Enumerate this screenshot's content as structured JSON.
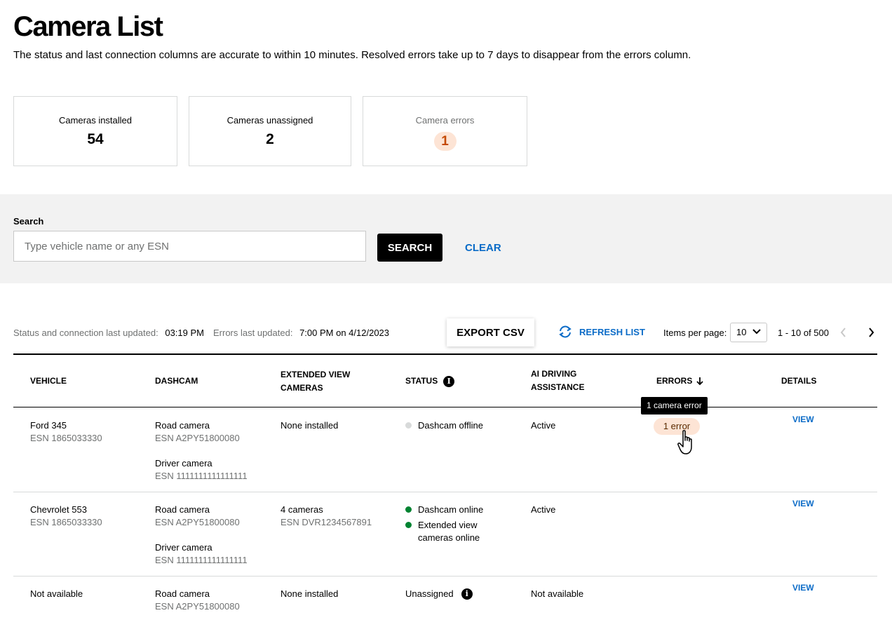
{
  "page": {
    "title": "Camera List",
    "description": "The status and last connection columns are accurate to within 10 minutes. Resolved errors take up to 7 days to disappear from the errors column."
  },
  "stats": [
    {
      "label": "Cameras installed",
      "value": "54"
    },
    {
      "label": "Cameras unassigned",
      "value": "2"
    },
    {
      "label": "Camera errors",
      "value": "1"
    }
  ],
  "search": {
    "label": "Search",
    "placeholder": "Type vehicle name or any ESN",
    "button": "SEARCH",
    "clear": "CLEAR"
  },
  "toolbar": {
    "status_updated_label": "Status and connection last updated:",
    "status_updated_value": "03:19 PM",
    "errors_updated_label": "Errors last updated:",
    "errors_updated_value": "7:00 PM on 4/12/2023",
    "export": "EXPORT CSV",
    "refresh": "REFRESH LIST",
    "items_per_page_label": "Items per page:",
    "items_per_page_value": "10",
    "range": "1 - 10 of 500"
  },
  "table": {
    "headers": {
      "vehicle": "VEHICLE",
      "dashcam": "DASHCAM",
      "extended_1": "EXTENDED VIEW",
      "extended_2": "CAMERAS",
      "status": "STATUS",
      "ai_1": "AI DRIVING",
      "ai_2": "ASSISTANCE",
      "errors": "ERRORS",
      "details": "DETAILS"
    },
    "rows": [
      {
        "vehicle": "Ford 345",
        "vehicle_esn": "ESN 1865033330",
        "road_label": "Road camera",
        "road_esn": "ESN A2PY51800080",
        "driver_label": "Driver camera",
        "driver_esn": "ESN 1111111111111111",
        "extended": "None installed",
        "status_1": "Dashcam offline",
        "ai": "Active",
        "error": "1 error",
        "details": "VIEW"
      },
      {
        "vehicle": "Chevrolet 553",
        "vehicle_esn": "ESN 1865033330",
        "road_label": "Road camera",
        "road_esn": "ESN A2PY51800080",
        "driver_label": "Driver camera",
        "driver_esn": "ESN 1111111111111111",
        "extended": "4 cameras",
        "extended_esn": "ESN DVR1234567891",
        "status_1": "Dashcam online",
        "status_2a": "Extended view",
        "status_2b": "cameras online",
        "ai": "Active",
        "details": "VIEW"
      },
      {
        "vehicle": "Not available",
        "road_label": "Road camera",
        "road_esn": "ESN A2PY51800080",
        "extended": "None installed",
        "status_1": "Unassigned",
        "ai": "Not available",
        "details": "VIEW"
      }
    ],
    "tooltip": "1 camera error"
  },
  "colors": {
    "link": "#0a6bc7",
    "online": "#008331",
    "offline": "#d8dada",
    "error_bg": "#fde4d5",
    "error_text": "#c44900"
  },
  "icons": [
    "info-icon",
    "sort-down-arrow-icon",
    "refresh-icon",
    "chevron-down-icon",
    "chevron-left-icon",
    "chevron-right-icon",
    "hand-pointer-cursor-icon"
  ]
}
